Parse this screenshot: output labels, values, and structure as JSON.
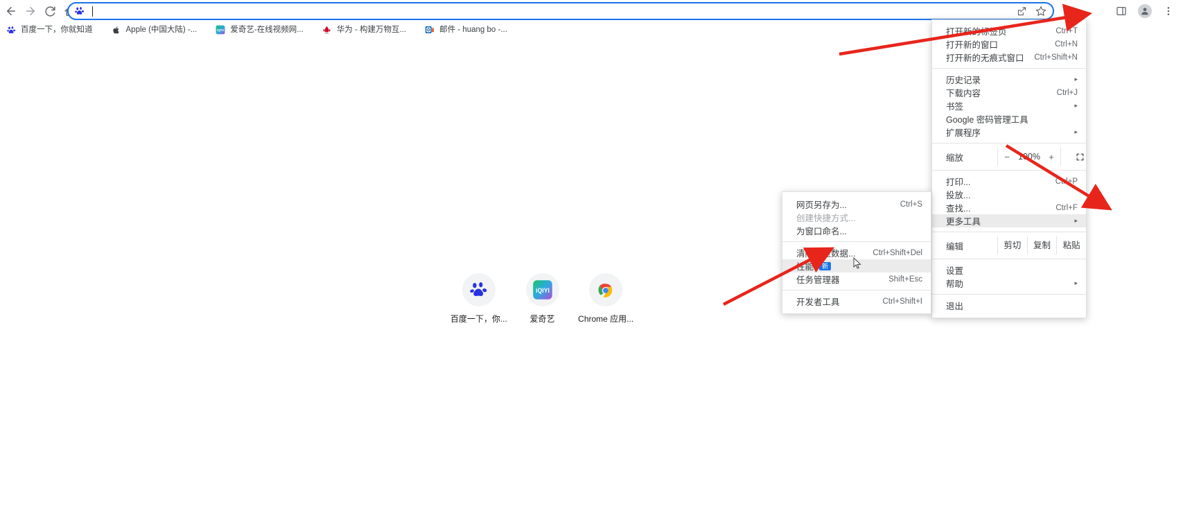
{
  "browser": {
    "omnibox": {
      "value": "",
      "placeholder": "",
      "favicon_name": "baidu-favicon",
      "share_icon": "share-icon",
      "bookmark_star_icon": "star-icon"
    },
    "nav": {
      "back_label": "←",
      "forward_label": "→",
      "reload_label": "↻",
      "home_label": "⌂"
    },
    "toolbar_right": {
      "side_panel_icon": "side-panel-icon",
      "profile_icon": "profile-avatar-icon",
      "menu_icon": "three-dot-menu-icon"
    }
  },
  "bookmarks": [
    {
      "label": "百度一下，你就知道",
      "icon": "baidu-favicon"
    },
    {
      "label": "Apple (中国大陆) -...",
      "icon": "apple-favicon"
    },
    {
      "label": "爱奇艺-在线视频网...",
      "icon": "iqiyi-favicon"
    },
    {
      "label": "华为 - 构建万物互...",
      "icon": "huawei-favicon"
    },
    {
      "label": "邮件 - huang bo -...",
      "icon": "outlook-favicon"
    }
  ],
  "newtab": {
    "shortcuts": [
      {
        "label": "百度一下，你...",
        "icon": "baidu-tile-icon"
      },
      {
        "label": "爱奇艺",
        "icon": "iqiyi-tile-icon"
      },
      {
        "label": "Chrome 应用...",
        "icon": "chrome-apps-tile-icon"
      }
    ]
  },
  "main_menu": {
    "items": [
      {
        "label": "打开新的标签页",
        "accel": "Ctrl+T",
        "arrow": false
      },
      {
        "label": "打开新的窗口",
        "accel": "Ctrl+N",
        "arrow": false
      },
      {
        "label": "打开新的无痕式窗口",
        "accel": "Ctrl+Shift+N",
        "arrow": false
      },
      {
        "label": "历史记录",
        "accel": "",
        "arrow": true
      },
      {
        "label": "下载内容",
        "accel": "Ctrl+J",
        "arrow": false
      },
      {
        "label": "书签",
        "accel": "",
        "arrow": true
      },
      {
        "label": "Google 密码管理工具",
        "accel": "",
        "arrow": false
      },
      {
        "label": "扩展程序",
        "accel": "",
        "arrow": true
      },
      {
        "label": "打印...",
        "accel": "Ctrl+P",
        "arrow": false
      },
      {
        "label": "投放...",
        "accel": "",
        "arrow": false
      },
      {
        "label": "查找...",
        "accel": "Ctrl+F",
        "arrow": false
      },
      {
        "label": "更多工具",
        "accel": "",
        "arrow": true
      },
      {
        "label": "设置",
        "accel": "",
        "arrow": false
      },
      {
        "label": "帮助",
        "accel": "",
        "arrow": true
      },
      {
        "label": "退出",
        "accel": "",
        "arrow": false
      }
    ],
    "zoom_row": {
      "label": "缩放",
      "minus": "−",
      "percent": "100%",
      "plus": "+",
      "fullscreen_icon": "fullscreen-icon"
    },
    "edit_row": {
      "label": "编辑",
      "cut": "剪切",
      "copy": "复制",
      "paste": "粘贴"
    }
  },
  "sub_menu": {
    "items": [
      {
        "label": "网页另存为...",
        "accel": "Ctrl+S",
        "disabled": false,
        "highlight": false,
        "badge": ""
      },
      {
        "label": "创建快捷方式...",
        "accel": "",
        "disabled": true,
        "highlight": false,
        "badge": ""
      },
      {
        "label": "为窗口命名...",
        "accel": "",
        "disabled": false,
        "highlight": false,
        "badge": ""
      },
      {
        "label": "清除浏览数据...",
        "accel": "Ctrl+Shift+Del",
        "disabled": false,
        "highlight": false,
        "badge": ""
      },
      {
        "label": "性能",
        "accel": "",
        "disabled": false,
        "highlight": true,
        "badge": "新"
      },
      {
        "label": "任务管理器",
        "accel": "Shift+Esc",
        "disabled": false,
        "highlight": false,
        "badge": ""
      },
      {
        "label": "开发者工具",
        "accel": "Ctrl+Shift+I",
        "disabled": false,
        "highlight": false,
        "badge": ""
      }
    ]
  },
  "annotations": {
    "arrow_color": "#e8251b",
    "count": 3
  },
  "colors": {
    "omnibox_focus": "#1a73e8",
    "menu_highlight": "#ebebeb",
    "badge_blue": "#1a73e8",
    "text_primary": "#3c4043",
    "text_secondary": "#5f6368"
  }
}
